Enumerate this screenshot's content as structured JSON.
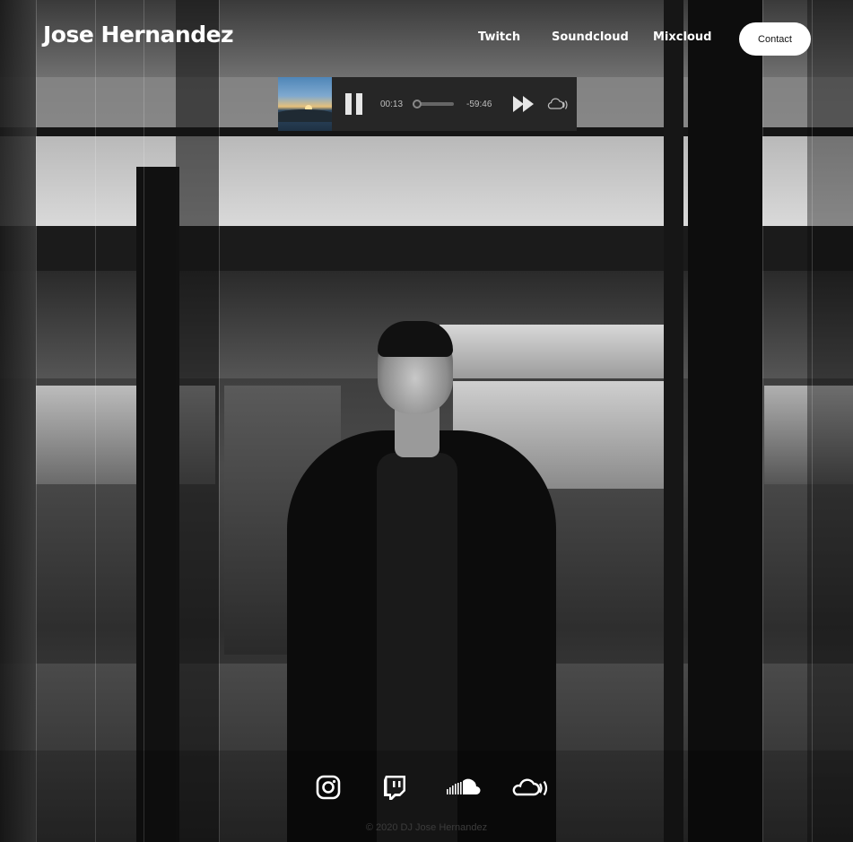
{
  "header": {
    "site_title": "Jose Hernandez",
    "nav": {
      "twitch": "Twitch",
      "soundcloud": "Soundcloud",
      "mixcloud": "Mixcloud"
    },
    "contact_label": "Contact"
  },
  "player": {
    "elapsed": "00:13",
    "remaining": "-59:46",
    "progress_fraction": 0.004
  },
  "footer": {
    "social_icons": [
      "instagram-icon",
      "twitch-icon",
      "soundcloud-icon",
      "mixcloud-icon"
    ],
    "copyright": "© 2020 DJ Jose Hernandez"
  },
  "colors": {
    "contact_button_bg": "#ffffff",
    "player_bg": "#262626",
    "text_light": "#ffffff"
  }
}
